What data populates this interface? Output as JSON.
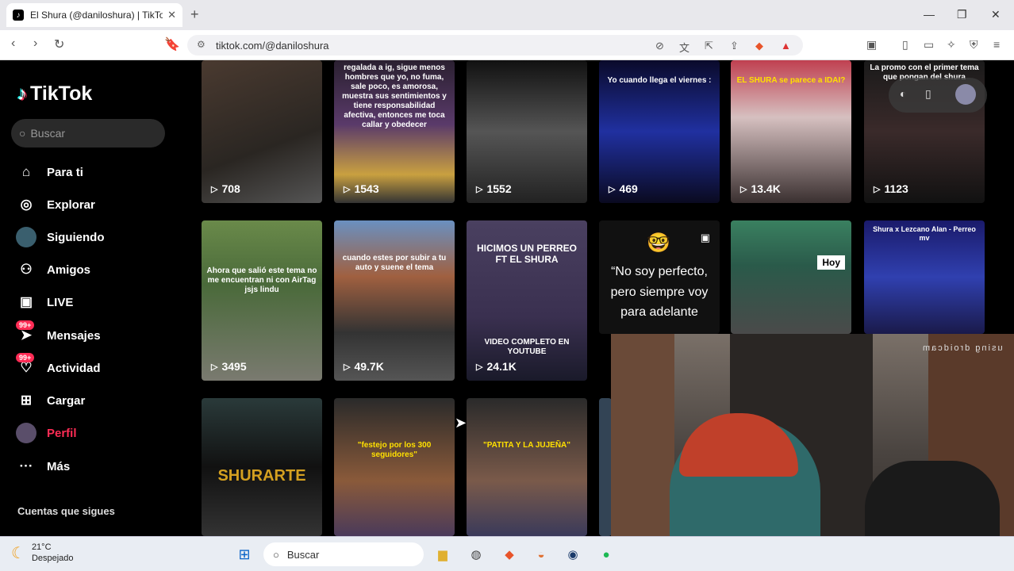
{
  "browser": {
    "tab_title": "El Shura (@daniloshura) | TikTok",
    "tab_favicon": "tiktok-icon",
    "url": "tiktok.com/@daniloshura"
  },
  "sidebar": {
    "logo_text": "TikTok",
    "search_placeholder": "Buscar",
    "items": [
      {
        "label": "Para ti",
        "icon": "home-icon"
      },
      {
        "label": "Explorar",
        "icon": "compass-icon"
      },
      {
        "label": "Siguiendo",
        "icon": "avatar-icon"
      },
      {
        "label": "Amigos",
        "icon": "friends-icon"
      },
      {
        "label": "LIVE",
        "icon": "live-icon"
      },
      {
        "label": "Mensajes",
        "icon": "messages-icon",
        "badge": "99+"
      },
      {
        "label": "Actividad",
        "icon": "activity-icon",
        "badge": "99+"
      },
      {
        "label": "Cargar",
        "icon": "upload-icon"
      },
      {
        "label": "Perfil",
        "icon": "profile-icon",
        "active": true
      },
      {
        "label": "Más",
        "icon": "more-icon"
      }
    ],
    "following_title": "Cuentas que sigues"
  },
  "videos": {
    "row1": [
      {
        "views": "708",
        "caption": ""
      },
      {
        "views": "1543",
        "caption": "regalada a ig, sigue menos hombres que yo, no fuma, sale poco, es amorosa, muestra sus sentimientos y tiene responsabilidad afectiva, entonces me toca callar y obedecer"
      },
      {
        "views": "1552",
        "caption": ""
      },
      {
        "views": "469",
        "caption": "Yo cuando llega el viernes :"
      },
      {
        "views": "13.4K",
        "caption": "EL SHURA se parece a IDAI?"
      },
      {
        "views": "1123",
        "caption": "La promo con el primer tema que pongan del shura"
      }
    ],
    "row2": [
      {
        "views": "3495",
        "caption": "Ahora que salió este tema no me encuentran ni con AirTag jsjs lindu"
      },
      {
        "views": "49.7K",
        "caption": "cuando estes por subir a tu auto y suene el tema"
      },
      {
        "views": "24.1K",
        "caption": "HICIMOS UN PERREO FT EL SHURA",
        "caption2": "VIDEO COMPLETO EN YOUTUBE"
      },
      {
        "views": "",
        "caption": "“No soy perfecto, pero siempre voy para adelante"
      },
      {
        "views": "",
        "caption": "Hoy"
      },
      {
        "views": "",
        "caption": "Shura x Lezcano Alan - Perreo mv"
      }
    ],
    "row3": [
      {
        "caption": "SHURARTE"
      },
      {
        "caption": "\"festejo por los 300 seguidores\""
      },
      {
        "caption": "\"PATITA Y LA JUJEÑA\""
      }
    ]
  },
  "webcam": {
    "label": "using droidcam"
  },
  "taskbar": {
    "temp": "21°C",
    "weather": "Despejado",
    "search_placeholder": "Buscar"
  }
}
